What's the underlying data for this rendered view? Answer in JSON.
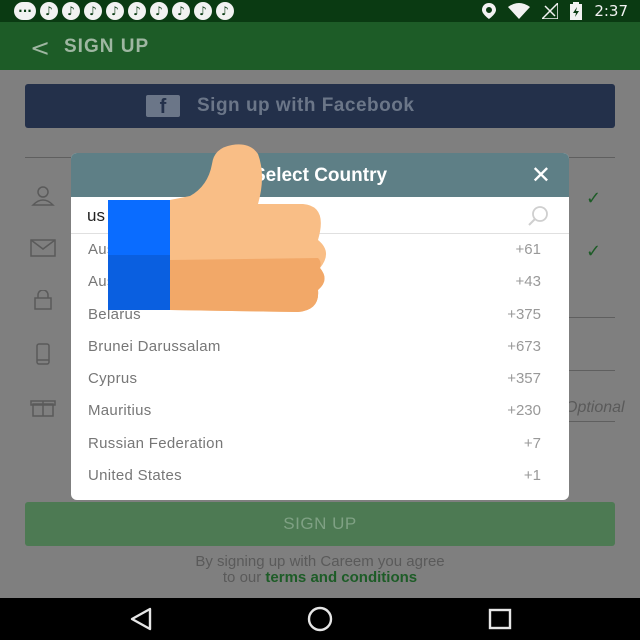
{
  "status_bar": {
    "time": "2:37",
    "left_icons": [
      "message-icon",
      "app-notification-icon",
      "app-notification-icon",
      "app-notification-icon",
      "app-notification-icon",
      "app-notification-icon",
      "app-notification-icon",
      "app-notification-icon",
      "app-notification-icon",
      "app-notification-icon",
      "app-notification-icon"
    ],
    "right_icons": [
      "location-icon",
      "wifi-icon",
      "signal-icon",
      "battery-icon"
    ]
  },
  "app_bar": {
    "title": "SIGN UP",
    "back_icon": "back-arrow-icon"
  },
  "facebook_button": {
    "label": "Sign up with Facebook",
    "icon": "facebook-icon"
  },
  "form": {
    "fields": [
      {
        "icon": "person-icon",
        "checked": true
      },
      {
        "icon": "mail-icon",
        "checked": true
      },
      {
        "icon": "lock-icon",
        "checked": false
      },
      {
        "icon": "phone-icon",
        "checked": false
      },
      {
        "icon": "gift-icon",
        "checked": false
      }
    ],
    "optional_label": "Optional",
    "signup_button": "SIGN UP",
    "agree_text": "By signing up with Careem you agree",
    "agree_prefix": "to our",
    "terms_link": "terms and conditions"
  },
  "dialog": {
    "title": "Select Country",
    "title_visible": "ect Country",
    "close_icon": "close-icon",
    "search": {
      "value": "us",
      "visible_value": "u",
      "icon": "search-icon"
    },
    "countries": [
      {
        "name": "Australia",
        "visible_name": "Au",
        "code": "+61"
      },
      {
        "name": "Austria",
        "visible_name": "Au",
        "code": "+43"
      },
      {
        "name": "Belarus",
        "code": "+375"
      },
      {
        "name": "Brunei Darussalam",
        "code": "+673"
      },
      {
        "name": "Cyprus",
        "code": "+357"
      },
      {
        "name": "Mauritius",
        "code": "+230"
      },
      {
        "name": "Russian Federation",
        "code": "+7"
      },
      {
        "name": "United States",
        "code": "+1"
      }
    ]
  },
  "overlay": {
    "emoji": "thumbs-up-icon",
    "bar_color": "#0a6cff"
  },
  "nav_bar": {
    "buttons": [
      "back-triangle-icon",
      "home-circle-icon",
      "recents-square-icon"
    ]
  },
  "colors": {
    "app_bar": "#1d5c27",
    "dialog_header": "#5e7f86",
    "facebook": "#23304a",
    "signup": "#4d7a53"
  }
}
